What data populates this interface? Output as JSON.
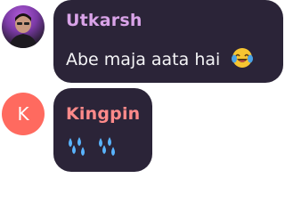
{
  "colors": {
    "bubble_bg": "#2b2438",
    "utkarsh_name": "#d9a3e8",
    "kingpin_name": "#ff8a8a",
    "kingpin_avatar": "#ff6a5f"
  },
  "messages": [
    {
      "sender": "Utkarsh",
      "avatar": "photo-avatar",
      "text": "Abe maja aata hai",
      "emoji": "face-with-tears-of-joy-icon"
    },
    {
      "sender": "Kingpin",
      "avatar_letter": "K",
      "text": "",
      "emoji": "sweat-droplets-icon-x2"
    }
  ]
}
